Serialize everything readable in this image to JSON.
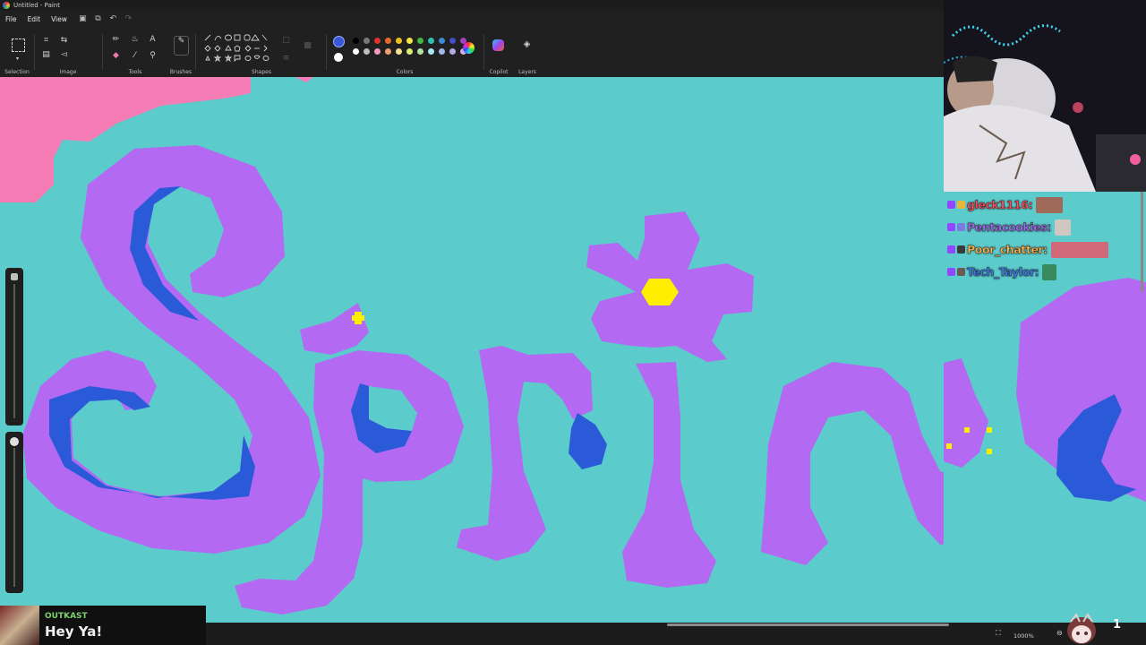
{
  "window": {
    "title": "Untitled - Paint"
  },
  "menu": {
    "file": "File",
    "edit": "Edit",
    "view": "View"
  },
  "ribbon": {
    "groups": {
      "selection": "Selection",
      "image": "Image",
      "tools": "Tools",
      "brushes": "Brushes",
      "shapes": "Shapes",
      "colors": "Colors",
      "copilot": "Copilot",
      "layers": "Layers"
    },
    "primary_color": "#3a57d8",
    "secondary_color": "#ffffff",
    "palette_row1": [
      "#000000",
      "#7a7a7a",
      "#e03030",
      "#e86a2a",
      "#f0c020",
      "#f4e640",
      "#40b840",
      "#30c0b0",
      "#3a8ad8",
      "#4050c8",
      "#a040c0"
    ],
    "palette_row2": [
      "#ffffff",
      "#c0c0c0",
      "#f49ac0",
      "#f0a070",
      "#f8e090",
      "#d8f070",
      "#b0e0a0",
      "#a8e8f0",
      "#a0b8e8",
      "#b8a8e0",
      "#d8b0e8"
    ]
  },
  "canvas": {
    "background": "#5bcbcb",
    "letter_fill": "#b469f2",
    "shadow_fill": "#2a5ad8",
    "accent_fill": "#f57cb4",
    "flower_center": "#ffee00"
  },
  "status": {
    "zoom": "1000%"
  },
  "chat": {
    "messages": [
      {
        "user": "gleck1116:",
        "color": "#ff4d5e"
      },
      {
        "user": "Pentacookies:",
        "color": "#a26cf0"
      },
      {
        "user": "Poor_chatter:",
        "color": "#ffb84d"
      },
      {
        "user": "Tech_Taylor:",
        "color": "#3d7df0"
      }
    ]
  },
  "now_playing": {
    "artist": "OUTKAST",
    "song": "Hey Ya!"
  },
  "overlay": {
    "count": "1"
  }
}
